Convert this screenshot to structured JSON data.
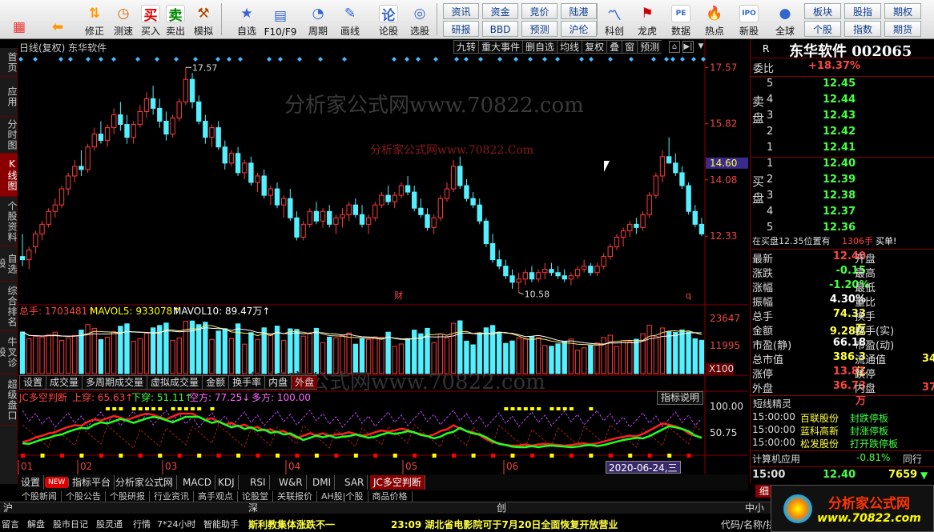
{
  "toolbar": {
    "big": [
      {
        "label": "",
        "icon": "windows-icon"
      },
      {
        "label": "",
        "icon": "back-arrow-icon"
      },
      {
        "label": "修正",
        "icon": "up-down-icon"
      },
      {
        "label": "测速",
        "icon": "clock-icon"
      },
      {
        "label": "买入",
        "icon": "buy-icon",
        "glyph": "买"
      },
      {
        "label": "卖出",
        "icon": "sell-icon",
        "glyph": "卖"
      },
      {
        "label": "模拟",
        "icon": "hammer-icon"
      },
      {
        "label": "自选",
        "icon": "star-icon"
      },
      {
        "label": "F10/F9",
        "icon": "f10-icon"
      },
      {
        "label": "周期",
        "icon": "cycle-icon"
      },
      {
        "label": "画线",
        "icon": "pencil-icon"
      },
      {
        "label": "论股",
        "icon": "discuss-icon",
        "glyph": "论"
      },
      {
        "label": "选股",
        "icon": "select-icon"
      }
    ],
    "small_top": [
      "资讯",
      "资金",
      "竞价",
      "陆港"
    ],
    "small_bottom": [
      "研报",
      "BBD",
      "预测",
      "沪伦"
    ],
    "big2": [
      {
        "label": "科创",
        "icon": "chart-icon"
      },
      {
        "label": "龙虎",
        "icon": "dragon-icon"
      },
      {
        "label": "数据",
        "icon": "pe-icon",
        "glyph": "PE"
      },
      {
        "label": "热点",
        "icon": "hot-icon"
      },
      {
        "label": "新股",
        "icon": "ipo-icon",
        "glyph": "IPO"
      },
      {
        "label": "全球",
        "icon": "globe-icon"
      }
    ],
    "right_top": [
      "板块",
      "股指",
      "期权"
    ],
    "right_bottom": [
      "个股",
      "指数",
      "期货"
    ]
  },
  "left_tabs": [
    "首页",
    "应用",
    "分时图",
    "K线图",
    "个股资料",
    "自选股",
    "综合排名",
    "牛叉诊股",
    "超级盘口"
  ],
  "chart_header": {
    "title": "日线(复权) 东华软件",
    "buttons": [
      "九转",
      "重大事件",
      "删自选",
      "均线",
      "复权",
      "叠",
      "窗",
      "预测"
    ]
  },
  "watermarks": [
    "分析家公式网www.70822.com",
    "分析家公式网www.70822.Com"
  ],
  "markers": {
    "fin": "财",
    "q": "q"
  },
  "chart_data": [
    {
      "type": "candlestick",
      "title": "日线(复权) 东华软件",
      "y_ticks": [
        17.57,
        15.82,
        14.08,
        12.33
      ],
      "current": "14.60",
      "annotations": {
        "high": "17.57",
        "low": "10.58"
      },
      "x_labels": [
        "01",
        "02",
        "03",
        "04",
        "05",
        "06"
      ],
      "candles": [
        [
          11.7,
          12.4,
          11.4,
          11.6
        ],
        [
          11.6,
          12.0,
          11.3,
          11.9
        ],
        [
          12.0,
          12.5,
          11.8,
          12.4
        ],
        [
          12.4,
          12.8,
          12.2,
          12.7
        ],
        [
          12.7,
          13.2,
          12.6,
          13.1
        ],
        [
          13.1,
          13.5,
          12.9,
          13.3
        ],
        [
          13.3,
          13.9,
          13.2,
          13.8
        ],
        [
          13.8,
          14.3,
          13.6,
          14.2
        ],
        [
          14.2,
          14.7,
          14.0,
          14.5
        ],
        [
          14.5,
          15.0,
          14.2,
          14.4
        ],
        [
          14.4,
          15.2,
          14.3,
          15.1
        ],
        [
          15.1,
          15.7,
          15.0,
          15.5
        ],
        [
          15.5,
          15.9,
          15.2,
          15.3
        ],
        [
          15.3,
          15.8,
          15.1,
          15.7
        ],
        [
          15.7,
          16.3,
          15.5,
          16.1
        ],
        [
          16.1,
          16.5,
          15.6,
          15.8
        ],
        [
          15.8,
          16.1,
          15.2,
          15.4
        ],
        [
          15.4,
          15.9,
          15.2,
          15.8
        ],
        [
          15.8,
          16.4,
          15.7,
          16.2
        ],
        [
          16.2,
          16.8,
          16.0,
          16.6
        ],
        [
          16.6,
          17.0,
          16.1,
          16.3
        ],
        [
          16.3,
          16.6,
          15.7,
          15.9
        ],
        [
          15.9,
          16.2,
          15.3,
          15.5
        ],
        [
          15.5,
          16.1,
          15.4,
          16.0
        ],
        [
          16.0,
          16.6,
          15.9,
          16.5
        ],
        [
          16.5,
          17.57,
          16.4,
          17.2
        ],
        [
          17.2,
          17.4,
          16.3,
          16.5
        ],
        [
          16.5,
          16.7,
          15.8,
          15.9
        ],
        [
          15.9,
          16.1,
          15.2,
          15.4
        ],
        [
          15.4,
          15.8,
          15.1,
          15.7
        ],
        [
          15.7,
          15.9,
          15.0,
          15.1
        ],
        [
          15.1,
          15.3,
          14.4,
          14.6
        ],
        [
          14.6,
          15.0,
          14.5,
          14.9
        ],
        [
          14.9,
          15.1,
          14.2,
          14.3
        ],
        [
          14.3,
          14.7,
          14.1,
          14.6
        ],
        [
          14.6,
          14.8,
          13.9,
          14.0
        ],
        [
          14.0,
          14.3,
          13.7,
          14.2
        ],
        [
          14.2,
          14.4,
          13.5,
          13.6
        ],
        [
          13.6,
          13.9,
          13.3,
          13.8
        ],
        [
          13.8,
          14.0,
          13.2,
          13.3
        ],
        [
          13.3,
          13.6,
          12.9,
          13.5
        ],
        [
          13.5,
          13.8,
          12.8,
          12.9
        ],
        [
          12.9,
          13.1,
          12.2,
          12.3
        ],
        [
          12.3,
          12.8,
          12.2,
          12.7
        ],
        [
          12.7,
          13.2,
          12.6,
          13.1
        ],
        [
          13.1,
          13.4,
          12.7,
          12.8
        ],
        [
          12.8,
          13.2,
          12.6,
          13.1
        ],
        [
          13.1,
          13.3,
          12.6,
          12.7
        ],
        [
          12.7,
          13.0,
          12.4,
          12.9
        ],
        [
          12.9,
          13.2,
          12.6,
          13.0
        ],
        [
          13.0,
          13.4,
          12.8,
          13.3
        ],
        [
          13.3,
          13.5,
          12.9,
          13.0
        ],
        [
          13.0,
          13.3,
          12.6,
          12.7
        ],
        [
          12.7,
          13.0,
          12.4,
          12.9
        ],
        [
          12.9,
          13.4,
          12.8,
          13.3
        ],
        [
          13.3,
          13.7,
          13.2,
          13.6
        ],
        [
          13.6,
          13.9,
          13.3,
          13.4
        ],
        [
          13.4,
          13.7,
          13.2,
          13.6
        ],
        [
          13.6,
          14.0,
          13.5,
          13.9
        ],
        [
          13.9,
          14.2,
          13.6,
          13.7
        ],
        [
          13.7,
          13.9,
          13.1,
          13.2
        ],
        [
          13.2,
          13.5,
          12.9,
          13.0
        ],
        [
          13.0,
          13.2,
          12.5,
          12.6
        ],
        [
          12.6,
          13.0,
          12.4,
          12.9
        ],
        [
          12.9,
          13.6,
          12.8,
          13.5
        ],
        [
          13.5,
          14.0,
          13.4,
          13.8
        ],
        [
          13.8,
          14.7,
          13.7,
          14.5
        ],
        [
          14.5,
          14.8,
          13.8,
          13.9
        ],
        [
          13.9,
          14.1,
          13.4,
          13.5
        ],
        [
          13.5,
          13.7,
          13.2,
          13.3
        ],
        [
          13.3,
          13.5,
          12.7,
          12.8
        ],
        [
          12.8,
          12.9,
          12.0,
          12.1
        ],
        [
          12.1,
          12.4,
          11.5,
          11.6
        ],
        [
          11.6,
          11.9,
          11.3,
          11.4
        ],
        [
          11.4,
          11.6,
          11.0,
          11.1
        ],
        [
          11.1,
          11.3,
          10.7,
          10.9
        ],
        [
          10.9,
          11.2,
          10.58,
          11.0
        ],
        [
          11.0,
          11.3,
          10.8,
          11.2
        ],
        [
          11.2,
          11.4,
          10.9,
          11.0
        ],
        [
          11.0,
          11.3,
          10.9,
          11.2
        ],
        [
          11.2,
          11.5,
          11.0,
          11.3
        ],
        [
          11.3,
          11.5,
          11.1,
          11.2
        ],
        [
          11.2,
          11.4,
          11.0,
          11.1
        ],
        [
          11.1,
          11.3,
          10.9,
          11.0
        ],
        [
          11.0,
          11.2,
          10.8,
          11.1
        ],
        [
          11.1,
          11.4,
          11.0,
          11.3
        ],
        [
          11.3,
          11.6,
          11.2,
          11.4
        ],
        [
          11.4,
          11.5,
          11.1,
          11.2
        ],
        [
          11.2,
          11.5,
          11.1,
          11.4
        ],
        [
          11.4,
          11.8,
          11.3,
          11.7
        ],
        [
          11.7,
          12.1,
          11.6,
          12.0
        ],
        [
          12.0,
          12.4,
          11.9,
          12.3
        ],
        [
          12.3,
          12.6,
          12.0,
          12.5
        ],
        [
          12.5,
          12.8,
          12.3,
          12.7
        ],
        [
          12.7,
          12.9,
          12.4,
          12.6
        ],
        [
          12.6,
          13.1,
          12.5,
          13.0
        ],
        [
          13.0,
          13.7,
          12.9,
          13.6
        ],
        [
          13.6,
          14.3,
          13.5,
          14.2
        ],
        [
          14.2,
          15.0,
          14.0,
          14.8
        ],
        [
          14.8,
          15.4,
          14.6,
          14.6
        ],
        [
          14.6,
          14.9,
          14.2,
          14.3
        ],
        [
          14.3,
          14.5,
          13.8,
          13.9
        ],
        [
          13.9,
          14.0,
          13.0,
          13.1
        ],
        [
          13.1,
          13.3,
          12.6,
          12.7
        ],
        [
          12.7,
          12.9,
          12.33,
          12.4
        ]
      ]
    },
    {
      "type": "bar",
      "title": "总手",
      "legend": [
        "总手: 1703481↑",
        "MAVOL5: 933078↑",
        "MAVOL10: 89.47万↑"
      ],
      "y_ticks": [
        "23647",
        "11995"
      ],
      "unit": "X100",
      "tabs": [
        "设置",
        "成交量",
        "多周期成交量",
        "虚拟成交量",
        "金额",
        "换手率",
        "内盘",
        "外盘"
      ]
    },
    {
      "type": "line",
      "title": "JC多空判断",
      "legend": [
        "JC多空判断",
        "上穿: 65.63↑",
        "下穿: 51.11↑",
        "空方: 77.25↓",
        "多方: 100.00"
      ],
      "y_ticks": [
        "100.00",
        "50.75"
      ],
      "button": "指标说明",
      "date": "2020-06-24,三"
    }
  ],
  "right_panel": {
    "title": "东华软件 002065",
    "r": "R",
    "weibi": {
      "label": "委比",
      "value": "+18.37%"
    },
    "sell_label": "卖盘",
    "buy_label": "买盘",
    "sell": [
      {
        "n": "5",
        "p": "12.45"
      },
      {
        "n": "4",
        "p": "12.44"
      },
      {
        "n": "3",
        "p": "12.43"
      },
      {
        "n": "2",
        "p": "12.42"
      },
      {
        "n": "1",
        "p": "12.41"
      }
    ],
    "buy": [
      {
        "n": "1",
        "p": "12.40"
      },
      {
        "n": "2",
        "p": "12.39"
      },
      {
        "n": "3",
        "p": "12.38"
      },
      {
        "n": "4",
        "p": "12.37"
      },
      {
        "n": "5",
        "p": "12.36"
      }
    ],
    "status": {
      "a": "在买盘12.35位置有",
      "b": "1306手",
      "c": "买单!"
    },
    "quotes": [
      {
        "l": "最新",
        "v": "12.40",
        "r": "开盘"
      },
      {
        "l": "涨跌",
        "v": "-0.15",
        "r": "最高"
      },
      {
        "l": "涨幅",
        "v": "-1.20%",
        "r": "最低"
      },
      {
        "l": "振幅",
        "v": "4.30%",
        "r": "量比"
      },
      {
        "l": "总手",
        "v": "74.33万",
        "r": "换手"
      },
      {
        "l": "金额",
        "v": "9.28亿",
        "r": "换手(实)"
      },
      {
        "l": "市盈(静)",
        "v": "66.18",
        "r": "市盈(动)"
      },
      {
        "l": "总市值",
        "v": "386.3亿",
        "r": "流通值"
      },
      {
        "l": "涨停",
        "v": "13.81",
        "r": "跌停"
      },
      {
        "l": "外盘",
        "v": "36.73万",
        "r": "内盘"
      }
    ],
    "right_clip": [
      "34",
      "37"
    ],
    "news_title": "短线精灵",
    "news": [
      {
        "t": "15:00:00",
        "s": "百联股份",
        "e": "封跌停板"
      },
      {
        "t": "15:00:00",
        "s": "蓝科高新",
        "e": "封涨停板"
      },
      {
        "t": "15:00:00",
        "s": "松发股份",
        "e": "打开跌停板"
      }
    ],
    "sector": {
      "name": "计算机应用",
      "pct": "-0.81%",
      "extra": "同行"
    },
    "tick": {
      "time": "15:00",
      "price": "12.40",
      "vol": "7659"
    },
    "tick_btn": "细"
  },
  "bottom_tabs": [
    "设置",
    "NEW",
    "指标平台",
    "分析家公式网",
    "MACD",
    "KDJ",
    "RSI",
    "W&R",
    "DMI",
    "SAR",
    "JC多空判断"
  ],
  "bottom": {
    "row1": [
      "个股新闻",
      "个股公告",
      "个股研报",
      "行业资讯",
      "高手观点",
      "论股堂",
      "关联报价",
      "AH股|个股",
      "商品价格"
    ],
    "row2": [
      "沪",
      "深",
      "创",
      "中小"
    ],
    "status_items": [
      "留言",
      "解盘",
      "股市日记",
      "股灵通",
      "行情",
      "7*24小时",
      "智能助手"
    ],
    "ticker1": "斯利教集体涨跌不一",
    "ticker2": "23:09 湖北省电影院可于7月20日全面恢复开放营业",
    "right": "代码/名称/拼音"
  },
  "logo": {
    "text": "分析家公式网",
    "url": "www.70822.com"
  }
}
